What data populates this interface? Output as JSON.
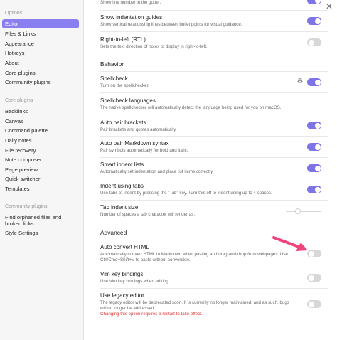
{
  "sidebar": {
    "options_header": "Options",
    "core_plugins_header": "Core plugins",
    "community_plugins_header": "Community plugins",
    "options": [
      "Editor",
      "Files & Links",
      "Appearance",
      "Hotkeys",
      "About",
      "Core plugins",
      "Community plugins"
    ],
    "core_plugins": [
      "Backlinks",
      "Canvas",
      "Command palette",
      "Daily notes",
      "File recovery",
      "Note composer",
      "Page preview",
      "Quick switcher",
      "Templates"
    ],
    "community_plugins": [
      "Find orphaned files and broken links",
      "Style Settings"
    ],
    "active": "Editor"
  },
  "close_icon": "close-icon",
  "settings": {
    "line_number_desc": "Show line number in the gutter.",
    "indent_guides": {
      "name": "Show indentation guides",
      "desc": "Show vertical relationship lines between bullet points for visual guidance.",
      "on": true
    },
    "rtl": {
      "name": "Right-to-left (RTL)",
      "desc": "Sets the text direction of notes to display in right-to-left.",
      "on": false
    },
    "behavior_header": "Behavior",
    "spellcheck": {
      "name": "Spellcheck",
      "desc": "Turn on the spellchecker."
    },
    "spellcheck_languages": {
      "name": "Spellcheck languages",
      "desc": "The native spellchecker will automatically detect the language being used for you on macOS."
    },
    "auto_pair_brackets": {
      "name": "Auto pair brackets",
      "desc": "Pair brackets and quotes automatically.",
      "on": true
    },
    "auto_pair_markdown": {
      "name": "Auto pair Markdown syntax",
      "desc": "Pair symbols automatically for bold and italic.",
      "on": true
    },
    "smart_indent": {
      "name": "Smart indent lists",
      "desc": "Automatically set indentation and place list items correctly.",
      "on": true
    },
    "indent_tabs": {
      "name": "Indent using tabs",
      "desc": "Use tabs to indent by pressing the \"Tab\" key. Turn this off to indent using up to 4 spaces.",
      "on": true
    },
    "tab_indent_size": {
      "name": "Tab indent size",
      "desc": "Number of spaces a tab character will render as.",
      "value_fraction": 0.3
    },
    "advanced_header": "Advanced",
    "auto_convert_html": {
      "name": "Auto convert HTML",
      "desc": "Automatically convert HTML to Markdown when pasting and drag-and-drop from webpages. Use Ctrl/Cmd+Shift+V to paste without conversion.",
      "on": false
    },
    "vim": {
      "name": "Vim key bindings",
      "desc": "Use Vim key bindings when editing.",
      "on": false
    },
    "legacy_editor": {
      "name": "Use legacy editor",
      "desc": "The legacy editor will be deprecated soon. It is currently no longer maintained, and as such, bugs will no longer be addressed.",
      "warning": "Changing this option requires a restart to take effect.",
      "on": false
    }
  },
  "colors": {
    "accent": "#7f73e8",
    "active_item": "#8a7ff0",
    "toggle_off": "#d7d7d7",
    "warning": "#e03a3a",
    "arrow": "#f0457a"
  }
}
